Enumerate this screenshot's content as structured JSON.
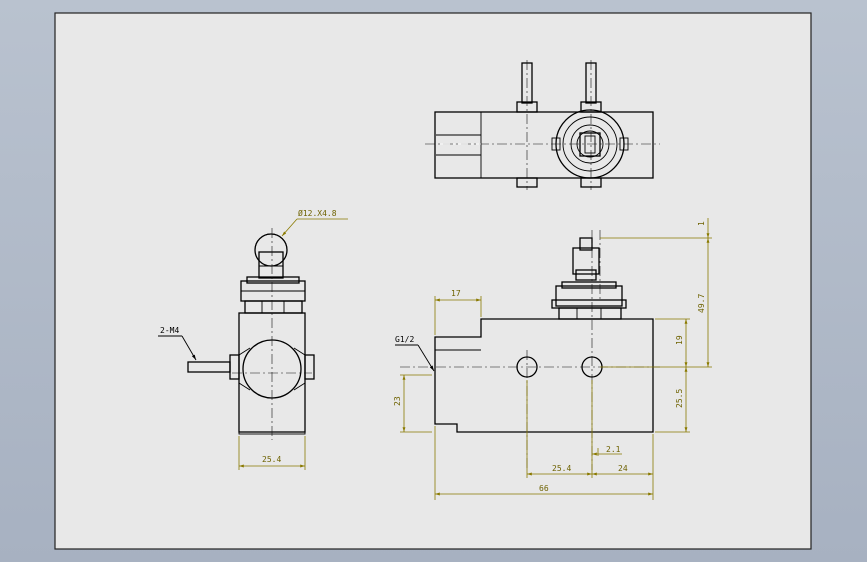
{
  "callouts": {
    "roller": "Ø12.X4.8",
    "screw": "2-M4",
    "thread": "G1/2"
  },
  "dimensions": {
    "side_width": "25.4",
    "top_width": "17",
    "height_23": "23",
    "top_offset": "1",
    "overall_height": "49.7",
    "upper_19": "19",
    "lower_25_5": "25.5",
    "offset_2_1": "2.1",
    "hole_spacing": "25.4",
    "edge_24": "24",
    "overall_length": "66"
  },
  "colors": {
    "background": "#b0b9c7",
    "sheet": "#e8e8e8",
    "lines": "#000000",
    "dimensions": "#8a7a00"
  }
}
